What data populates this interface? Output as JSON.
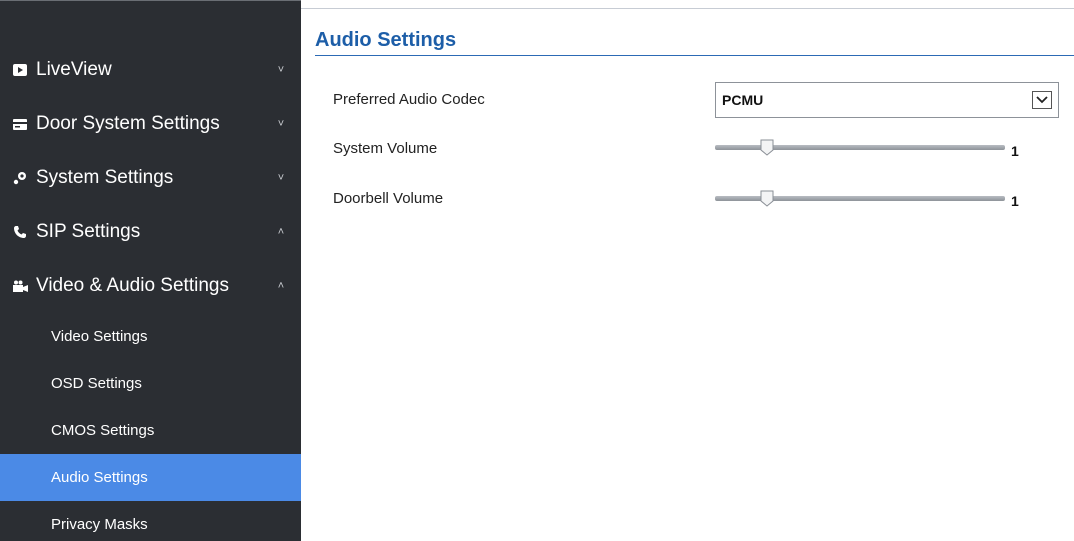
{
  "sidebar": {
    "items": [
      {
        "label": "LiveView",
        "icon": "play-square-icon",
        "chevron": "˅"
      },
      {
        "label": "Door System Settings",
        "icon": "door-card-icon",
        "chevron": "˅"
      },
      {
        "label": "System Settings",
        "icon": "system-gear-icon",
        "chevron": "˅"
      },
      {
        "label": "SIP Settings",
        "icon": "phone-icon",
        "chevron": "˄"
      },
      {
        "label": "Video & Audio Settings",
        "icon": "video-camera-icon",
        "chevron": "˄"
      }
    ],
    "subitems": [
      {
        "label": "Video Settings"
      },
      {
        "label": "OSD Settings"
      },
      {
        "label": "CMOS Settings"
      },
      {
        "label": "Audio Settings",
        "active": true
      },
      {
        "label": "Privacy Masks"
      }
    ]
  },
  "main": {
    "title": "Audio Settings",
    "codec": {
      "label": "Preferred Audio Codec",
      "value": "PCMU"
    },
    "system_volume": {
      "label": "System Volume",
      "value": "1"
    },
    "doorbell_volume": {
      "label": "Doorbell Volume",
      "value": "1"
    }
  },
  "colors": {
    "sidebar_bg": "#2b2e33",
    "active_bg": "#4b8ae6",
    "title": "#1d5ea8"
  }
}
